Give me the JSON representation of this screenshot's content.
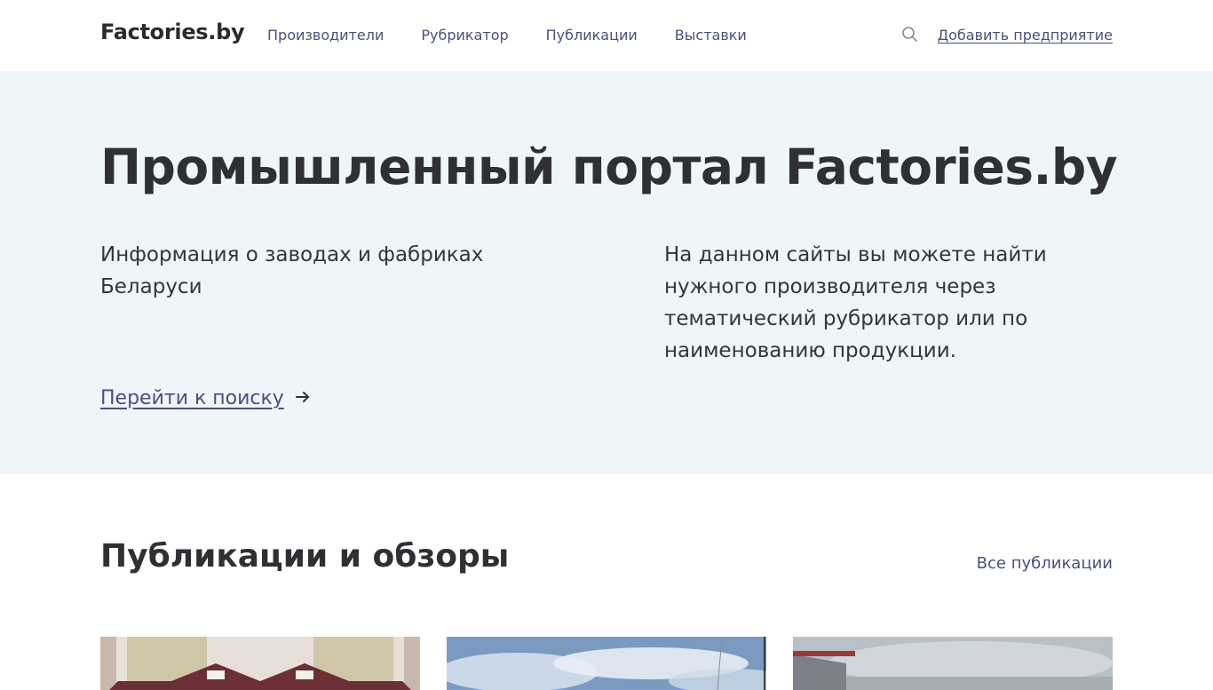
{
  "header": {
    "logo": "Factories.by",
    "nav": [
      {
        "label": "Производители"
      },
      {
        "label": "Рубрикатор"
      },
      {
        "label": "Публикации"
      },
      {
        "label": "Выставки"
      }
    ],
    "search_icon": "search-icon",
    "add_company": "Добавить предприятие"
  },
  "hero": {
    "title": "Промышленный портал Factories.by",
    "subtitle": "Информация о заводах и фабриках Беларуси",
    "description": "На данном сайты вы можете найти нужного производителя через тематический рубрикатор или по наименованию продукции.",
    "cta_label": "Перейти к поиску",
    "cta_icon": "arrow-right-icon"
  },
  "publications": {
    "title": "Публикации и обзоры",
    "all_link": "Все публикации",
    "cards": [
      {
        "image": "building-photo"
      },
      {
        "image": "sky-photo"
      },
      {
        "image": "factory-photo"
      }
    ]
  },
  "colors": {
    "accent": "#4a4f7c",
    "hero_bg": "#eff6fa",
    "text": "#2f3034"
  }
}
